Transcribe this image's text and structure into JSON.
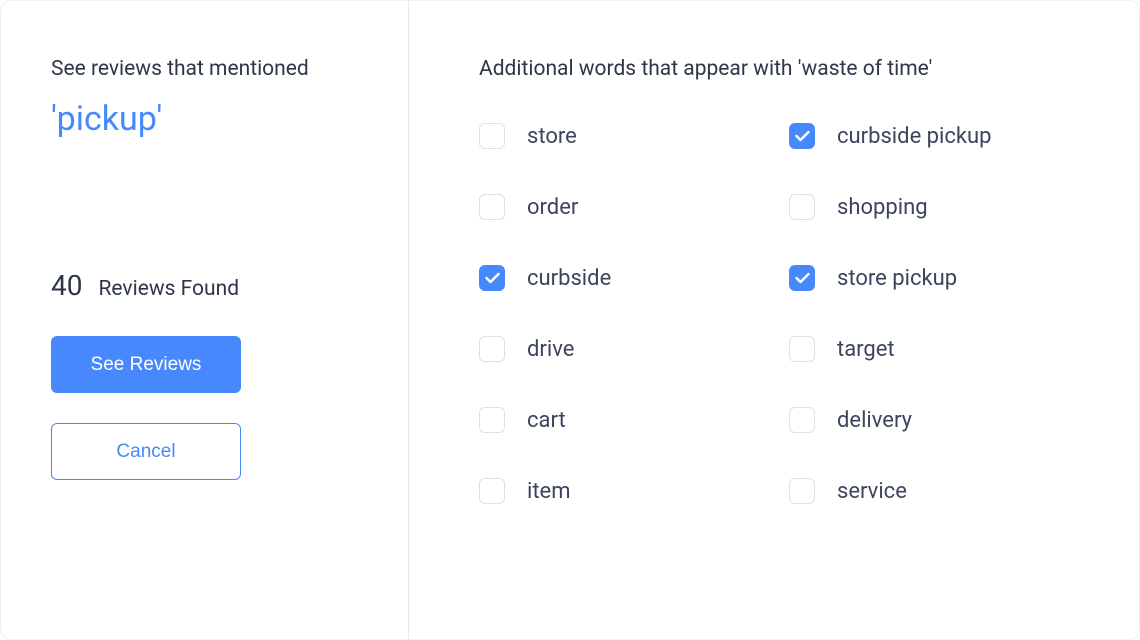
{
  "left": {
    "heading": "See reviews that mentioned",
    "keyword": "'pickup'",
    "reviews_count": "40",
    "reviews_label": "Reviews Found",
    "see_reviews_btn": "See Reviews",
    "cancel_btn": "Cancel"
  },
  "right": {
    "heading": "Additional words that appear with 'waste of time'",
    "options": [
      {
        "label": "store",
        "checked": false
      },
      {
        "label": "curbside pickup",
        "checked": true
      },
      {
        "label": "order",
        "checked": false
      },
      {
        "label": "shopping",
        "checked": false
      },
      {
        "label": "curbside",
        "checked": true
      },
      {
        "label": "store pickup",
        "checked": true
      },
      {
        "label": "drive",
        "checked": false
      },
      {
        "label": "target",
        "checked": false
      },
      {
        "label": "cart",
        "checked": false
      },
      {
        "label": "delivery",
        "checked": false
      },
      {
        "label": "item",
        "checked": false
      },
      {
        "label": "service",
        "checked": false
      }
    ]
  }
}
